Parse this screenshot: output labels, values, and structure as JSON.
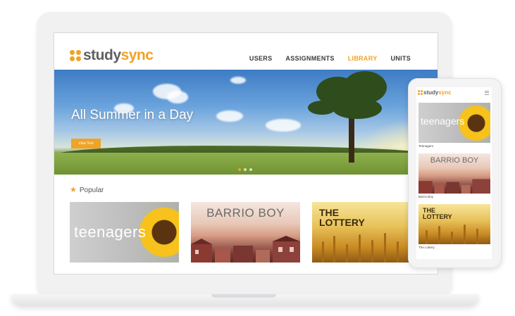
{
  "app": {
    "logo_study": "study",
    "logo_sync": "sync"
  },
  "nav": {
    "items": [
      {
        "label": "USERS",
        "active": false
      },
      {
        "label": "ASSIGNMENTS",
        "active": false
      },
      {
        "label": "LIBRARY",
        "active": true
      },
      {
        "label": "UNITS",
        "active": false
      }
    ]
  },
  "hero": {
    "title": "All Summer in a Day",
    "button_label": "View Text",
    "slide_count": 3,
    "active_slide": 1
  },
  "popular": {
    "heading": "Popular",
    "icon": "star-icon",
    "cards": [
      {
        "title": "teenagers"
      },
      {
        "title": "BARRIO BOY"
      },
      {
        "title": "THE LOTTERY"
      }
    ]
  },
  "phone": {
    "cards": [
      {
        "image_title": "teenagers",
        "caption": "Teenagers"
      },
      {
        "image_title": "BARRIO BOY",
        "caption": "Barrio Boy"
      },
      {
        "image_title": "THE LOTTERY",
        "caption": "The Lottery"
      }
    ]
  },
  "colors": {
    "accent": "#f0a324",
    "logo_gray": "#5f6062",
    "nav_text": "#3a3a3a"
  }
}
